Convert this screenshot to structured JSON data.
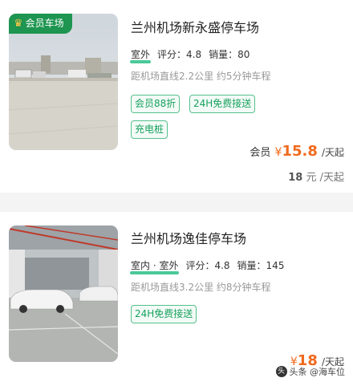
{
  "listings": [
    {
      "badge": "会员车场",
      "title": "兰州机场新永盛停车场",
      "location_type": "室外",
      "rating": "评分：4.8",
      "sales": "销量：80",
      "distance": "距机场直线2.2公里 约5分钟车程",
      "tags": [
        "会员88折",
        "24H免费接送",
        "充电桩"
      ],
      "member_label": "会员",
      "currency": "¥",
      "price": "15.8",
      "price_unit": "/天起",
      "original_price": "18",
      "original_unit": "元 /天起"
    },
    {
      "title": "兰州机场逸佳停车场",
      "location_type": "室内 · 室外",
      "rating": "评分：4.8",
      "sales": "销量：145",
      "distance": "距机场直线3.2公里 约8分钟车程",
      "tags": [
        "24H免费接送"
      ],
      "currency": "¥",
      "price": "18",
      "price_unit": "/天起"
    }
  ],
  "watermark": "头条 @海车位",
  "colors": {
    "accent_green": "#18a15d",
    "price_orange": "#f06a1e",
    "badge_green": "#1e9550"
  }
}
